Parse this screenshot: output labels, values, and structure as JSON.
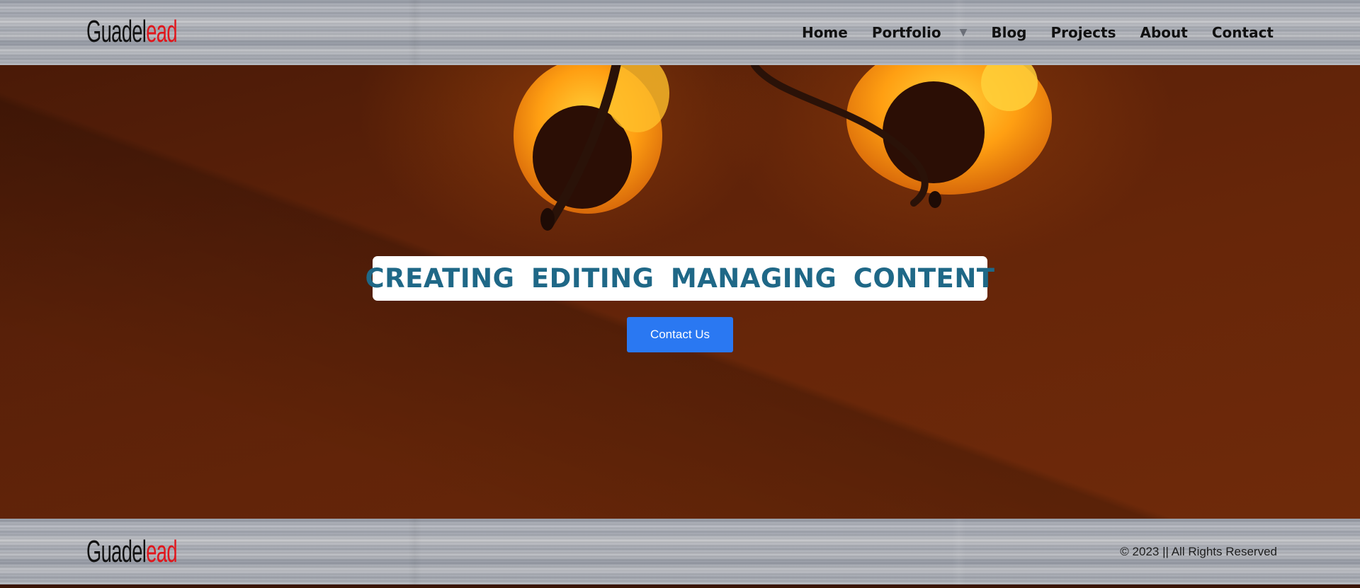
{
  "header": {
    "logo": {
      "part1": "Guadel",
      "part2": "ead"
    },
    "nav": {
      "home": "Home",
      "portfolio": "Portfolio",
      "blog": "Blog",
      "projects": "Projects",
      "about": "About",
      "contact": "Contact"
    }
  },
  "hero": {
    "headline": "CREATING EDITING MANAGING CONTENT",
    "cta_label": "Contact Us"
  },
  "footer": {
    "logo": {
      "part1": "Guadel",
      "part2": "ead"
    },
    "copyright": "© 2023 || All Rights Reserved"
  },
  "colors": {
    "accent_button": "#2a78f2",
    "headline_text": "#1f6887",
    "logo_red": "#e0161c"
  },
  "icons": {
    "portfolio_dropdown": "caret-down-icon"
  }
}
